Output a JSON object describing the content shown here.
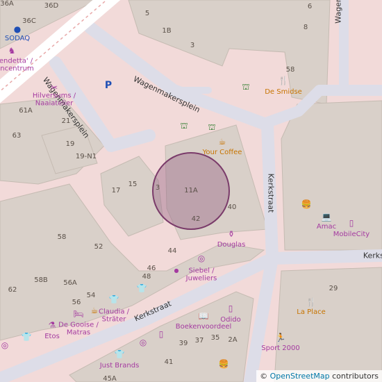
{
  "map": {
    "colors": {
      "background": "#f2dad9",
      "building": "#d9d0c9",
      "building_edge": "#c5bbb2",
      "pedestrian": "#dddde8",
      "highlight_fill": "#9b6a8a",
      "highlight_stroke": "#7a3b6a"
    },
    "streets": [
      {
        "id": "wagenmakersplein-1",
        "name": "Wagenmakersplein"
      },
      {
        "id": "wagenmakersplein-2",
        "name": "Wagenmakersplein"
      },
      {
        "id": "kerkstraat-vertical",
        "name": "Kerkstraat"
      },
      {
        "id": "kerkstraat-diagonal",
        "name": "Kerkstraat"
      },
      {
        "id": "kerkstraat-right",
        "name": "Kerkst"
      },
      {
        "id": "wagen-top",
        "name": "Wagen"
      }
    ],
    "house_numbers": [
      "36A",
      "36C",
      "36D",
      "5",
      "1B",
      "3",
      "6",
      "8",
      "58",
      "63",
      "61A",
      "21",
      "19",
      "19-N1",
      "17",
      "15",
      "3",
      "11A",
      "40",
      "42",
      "58",
      "52",
      "44",
      "46",
      "48",
      "58B",
      "56A",
      "56",
      "54",
      "62",
      "39",
      "37",
      "35",
      "2A",
      "41",
      "45A",
      "29"
    ],
    "pois": [
      {
        "id": "sodaq",
        "label": "SODAQ",
        "icon": "dot-icon",
        "category": "park"
      },
      {
        "id": "vendetta",
        "label": "Vendetta' / lencentrum",
        "icon": "horse-icon",
        "category": "shop"
      },
      {
        "id": "hilversums",
        "label": "Hilversums / Naaiatelier",
        "icon": "sewing-icon",
        "category": "shop"
      },
      {
        "id": "parking",
        "label": "P",
        "icon": "parking-bicycle-icon",
        "category": "park"
      },
      {
        "id": "de-smidse",
        "label": "De Smidse",
        "icon": "restaurant-icon",
        "category": "food"
      },
      {
        "id": "your-coffee",
        "label": "Your Coffee",
        "icon": "coffee-icon",
        "category": "food"
      },
      {
        "id": "douglas",
        "label": "Douglas",
        "icon": "perfume-icon",
        "category": "shop"
      },
      {
        "id": "siebel",
        "label": "Siebel / Juweliers",
        "icon": "jewelry-icon",
        "category": "shop"
      },
      {
        "id": "amac",
        "label": "Amac",
        "icon": "laptop-icon",
        "category": "shop"
      },
      {
        "id": "mobilecity",
        "label": "MobileCity",
        "icon": "phone-icon",
        "category": "shop"
      },
      {
        "id": "la-place",
        "label": "La Place",
        "icon": "restaurant-icon",
        "category": "food"
      },
      {
        "id": "claudia",
        "label": "Claudia / Sträter",
        "icon": "clothes-icon",
        "category": "shop"
      },
      {
        "id": "de-gooise",
        "label": "De Gooise / Matras",
        "icon": "bed-icon",
        "category": "shop"
      },
      {
        "id": "etos",
        "label": "Etos",
        "icon": "chemist-icon",
        "category": "shop"
      },
      {
        "id": "boekenvoordeel",
        "label": "Boekenvoordeel",
        "icon": "book-icon",
        "category": "shop"
      },
      {
        "id": "odido",
        "label": "Odido",
        "icon": "phone-icon",
        "category": "shop"
      },
      {
        "id": "sport2000",
        "label": "Sport 2000",
        "icon": "sport-icon",
        "category": "shop"
      },
      {
        "id": "just-brands",
        "label": "Just Brands",
        "icon": "clothes-icon",
        "category": "shop"
      }
    ],
    "attribution": {
      "symbol": "©",
      "link": "OpenStreetMap",
      "suffix": " contributors"
    }
  }
}
